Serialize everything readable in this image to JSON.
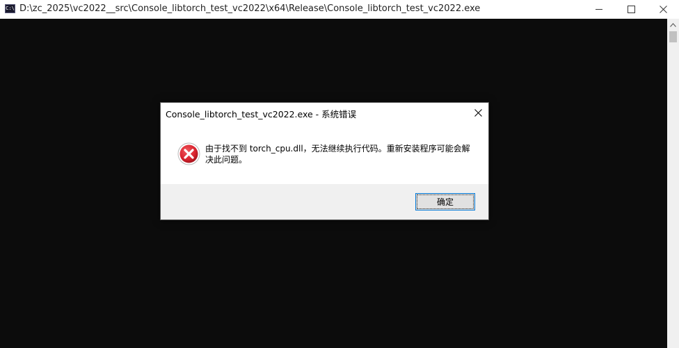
{
  "window": {
    "title": "D:\\zc_2025\\vc2022__src\\Console_libtorch_test_vc2022\\x64\\Release\\Console_libtorch_test_vc2022.exe",
    "icon_label": "C:\\",
    "icon": "console-app-icon",
    "controls": [
      "minimize-icon",
      "maximize-icon",
      "close-icon"
    ]
  },
  "console": {
    "background": "#0c0c0c"
  },
  "dialog": {
    "title": "Console_libtorch_test_vc2022.exe - 系统错误",
    "icon": "error-icon",
    "message": "由于找不到 torch_cpu.dll，无法继续执行代码。重新安装程序可能会解决此问题。",
    "ok_label": "确定"
  },
  "colors": {
    "error_red": "#d9232e",
    "focus_blue": "#0078d7",
    "footer_gray": "#f0f0f0"
  }
}
